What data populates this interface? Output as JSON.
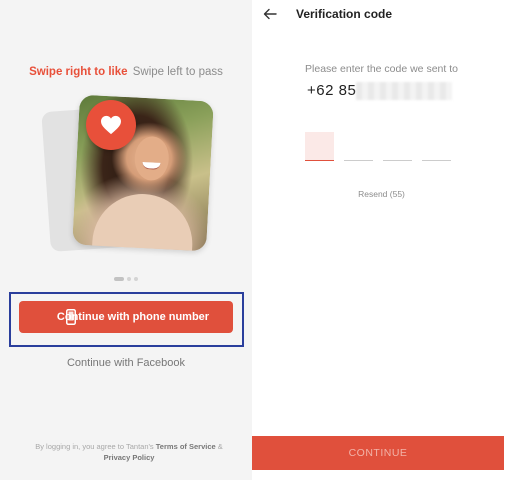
{
  "left": {
    "tagline_emphasis": "Swipe right to like",
    "tagline_rest": "Swipe left to pass",
    "carousel": {
      "count": 3,
      "active_index": 0
    },
    "phone_button_label": "Continue with phone number",
    "facebook_link": "Continue with Facebook",
    "legal": {
      "prefix": "By logging in, you agree to Tantan's",
      "terms": "Terms of Service",
      "amp": "&",
      "privacy": "Privacy Policy"
    },
    "icons": {
      "like": "heart-icon",
      "phone": "smartphone-icon"
    },
    "colors": {
      "accent": "#e0503c",
      "highlight_border": "#2a3e9c"
    }
  },
  "right": {
    "title": "Verification code",
    "instruction": "Please enter the code we sent to",
    "phone_number_visible": "+62 85",
    "code_boxes": [
      "",
      "",
      "",
      ""
    ],
    "active_code_index": 0,
    "resend_label": "Resend (55)",
    "continue_label": "CONTINUE",
    "icons": {
      "back": "back-arrow-icon"
    }
  }
}
